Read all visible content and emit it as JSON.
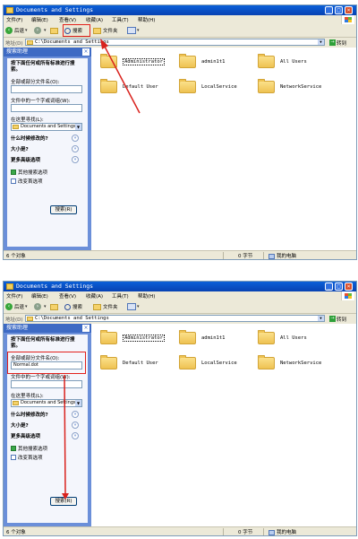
{
  "window": {
    "title": "Documents and Settings",
    "controls": [
      "_",
      "□",
      "×"
    ]
  },
  "menu": [
    "文件(F)",
    "编辑(E)",
    "查看(V)",
    "收藏(A)",
    "工具(T)",
    "帮助(H)"
  ],
  "toolbar": {
    "back_label": "后退",
    "search_label": "搜索",
    "folders_label": "文件夹"
  },
  "address": {
    "label": "地址(D)",
    "value": "C:\\Documents and Settings",
    "go_label": "转到"
  },
  "search_pane": {
    "header": "搜索助理",
    "instruction": "按下面任何或所有标准进行搜索。",
    "filename_label": "全部或部分文件名(O):",
    "phrase_label": "文件中的一个字或词组(W):",
    "lookin_label": "在这里寻找(L):",
    "lookin_value": "Documents and Settings",
    "when_modified": "什么时候修改的?",
    "what_size": "大小是?",
    "more_options": "更多高级选项",
    "other_options": "其他搜索选项",
    "change_prefs": "改变首选项",
    "search_button": "搜索(R)"
  },
  "shots": [
    {
      "filename_value": ""
    },
    {
      "filename_value": "Normal.dot"
    }
  ],
  "files": [
    "Administrator",
    "admin1t1",
    "All Users",
    "Default User",
    "LocalService",
    "NetworkService"
  ],
  "status": {
    "objects": "6 个对象",
    "size": "0 字节",
    "location": "我的电脑"
  },
  "annotation_color": "#e2201c"
}
